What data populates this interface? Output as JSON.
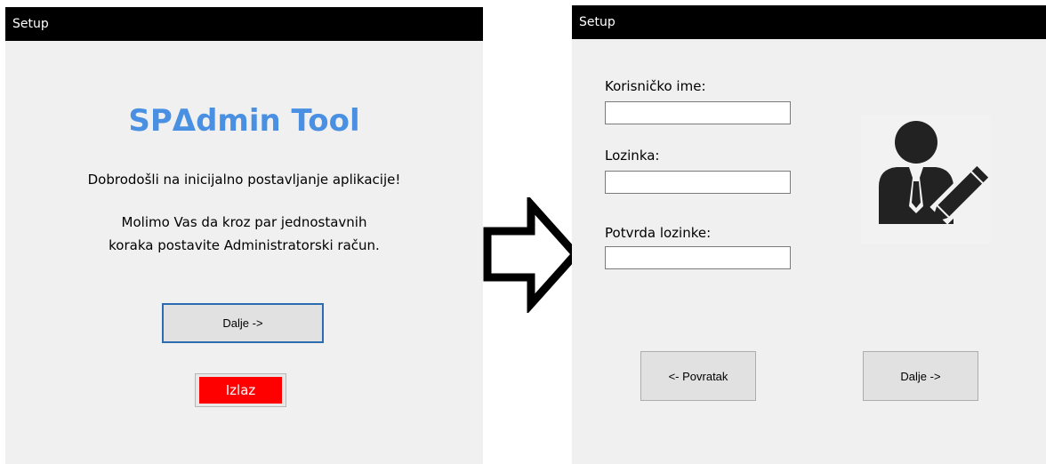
{
  "left_window": {
    "title": "Setup",
    "app_name": "SPΔdmin Tool",
    "welcome": "Dobrodošli na inicijalno postavljanje aplikacije!",
    "instruction_line1": "Molimo Vas da kroz par jednostavnih",
    "instruction_line2": "koraka postavite Administratorski račun.",
    "next_label": "Dalje ->",
    "exit_label": "Izlaz"
  },
  "right_window": {
    "title": "Setup",
    "username_label": "Korisničko ime:",
    "username_value": "",
    "password_label": "Lozinka:",
    "password_value": "",
    "confirm_label": "Potvrda lozinke:",
    "confirm_value": "",
    "back_label": "<- Povratak",
    "next_label": "Dalje ->"
  },
  "icons": {
    "transition": "arrow-right-icon",
    "user": "user-edit-icon"
  },
  "colors": {
    "titlebar": "#000000",
    "window_bg": "#f0f0f0",
    "brand": "#4a90e2",
    "exit_button": "#ff0000",
    "focus_border": "#2b6cb0"
  }
}
